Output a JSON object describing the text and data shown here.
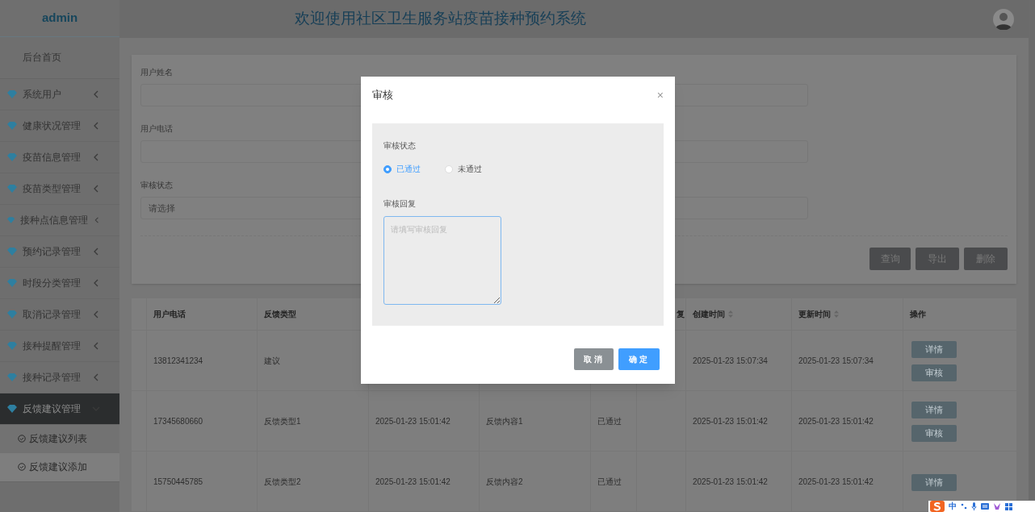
{
  "sidebar": {
    "brand": "admin",
    "home": "后台首页",
    "items": [
      {
        "label": "系统用户",
        "expanded": false
      },
      {
        "label": "健康状况管理",
        "expanded": false
      },
      {
        "label": "疫苗信息管理",
        "expanded": false
      },
      {
        "label": "疫苗类型管理",
        "expanded": false
      },
      {
        "label": "接种点信息管理",
        "expanded": false
      },
      {
        "label": "预约记录管理",
        "expanded": false
      },
      {
        "label": "时段分类管理",
        "expanded": false
      },
      {
        "label": "取消记录管理",
        "expanded": false
      },
      {
        "label": "接种提醒管理",
        "expanded": false
      },
      {
        "label": "接种记录管理",
        "expanded": false
      },
      {
        "label": "反馈建议管理",
        "expanded": true,
        "children": [
          {
            "label": "反馈建议列表",
            "selected": false
          },
          {
            "label": "反馈建议添加",
            "selected": true
          }
        ]
      }
    ]
  },
  "header": {
    "title": "欢迎使用社区卫生服务站疫苗接种预约系统"
  },
  "search": {
    "fields": [
      {
        "label": "用户姓名"
      },
      {
        "label": "用户电话"
      },
      {
        "label": "审核状态",
        "placeholder": "请选择"
      }
    ],
    "buttons": [
      "查询",
      "导出",
      "删除"
    ]
  },
  "table": {
    "columns": [
      {
        "label": "用户电话",
        "sortable": false
      },
      {
        "label": "反馈类型",
        "sortable": false
      },
      null,
      null,
      null,
      {
        "label": "复",
        "sortable": false
      },
      {
        "label": "创建时间",
        "sortable": true
      },
      {
        "label": "更新时间",
        "sortable": true
      },
      {
        "label": "操作",
        "sortable": false
      }
    ],
    "rows": [
      {
        "cells": [
          "13812341234",
          "建议",
          null,
          null,
          null,
          null,
          "2025-01-23 15:07:34",
          "2025-01-23 15:07:34"
        ],
        "actions": [
          "详情",
          "审核"
        ]
      },
      {
        "cells": [
          "17345680660",
          "反馈类型1",
          "2025-01-23 15:01:42",
          "反馈内容1",
          "已通过",
          null,
          "2025-01-23 15:01:42",
          "2025-01-23 15:01:42"
        ],
        "actions": [
          "详情",
          "审核"
        ]
      },
      {
        "cells": [
          "15750445785",
          "反馈类型2",
          "2025-01-23 15:01:42",
          "反馈内容2",
          "已通过",
          null,
          "2025-01-23 15:01:42",
          "2025-01-23 15:01:42"
        ],
        "actions": [
          "详情"
        ]
      }
    ]
  },
  "dialog": {
    "title": "审核",
    "close": "×",
    "status_label": "审核状态",
    "options": [
      {
        "label": "已通过",
        "selected": true
      },
      {
        "label": "未通过",
        "selected": false
      }
    ],
    "reply_label": "审核回复",
    "reply_placeholder": "请填写审核回复",
    "buttons": [
      {
        "label": "取消",
        "kind": "cancel"
      },
      {
        "label": "确定",
        "kind": "primary"
      }
    ]
  },
  "ime_toolbar": {
    "label": "中"
  }
}
